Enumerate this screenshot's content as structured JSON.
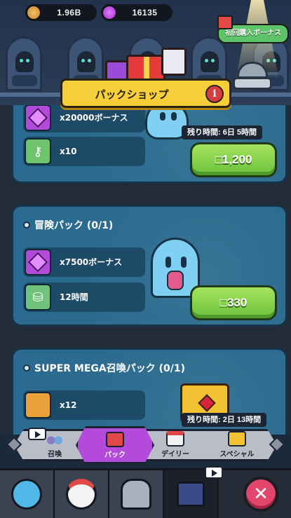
{
  "currency": {
    "coins": "1.96B",
    "gems": "16135",
    "coin_icon": "coin-icon",
    "gem_icon": "gem-icon"
  },
  "first_purchase_bonus": "初回購入ボーナス",
  "banner": {
    "title": "パックショップ",
    "info": "i"
  },
  "packs": [
    {
      "title": "",
      "items": [
        {
          "icon": "gem-icon",
          "label": "x20000ボーナス"
        },
        {
          "icon": "keys-icon",
          "label": "x10"
        }
      ],
      "timer": "残り時間: 6日 5時間",
      "price": "□1,200"
    },
    {
      "title": "冒険パック (0/1)",
      "items": [
        {
          "icon": "gem-icon",
          "label": "x7500ボーナス"
        },
        {
          "icon": "coins-icon",
          "label": "12時間"
        }
      ],
      "timer": "",
      "price": "□330"
    },
    {
      "title": "SUPER MEGA召喚パック (0/1)",
      "items": [
        {
          "icon": "chest-icon",
          "label": "x12"
        }
      ],
      "timer": "残り時間: 2日 13時間",
      "price": ""
    }
  ],
  "tabs": [
    {
      "label": "召喚",
      "icon": "summon-orbs-icon"
    },
    {
      "label": "パック",
      "icon": "gift-box-icon"
    },
    {
      "label": "デイリー",
      "icon": "calendar-icon"
    },
    {
      "label": "スペシャル",
      "icon": "gold-gift-icon"
    }
  ],
  "active_tab": "パック",
  "bottom_nav": [
    {
      "icon": "blue-ghost-icon"
    },
    {
      "icon": "chicken-icon"
    },
    {
      "icon": "ghost-pod-icon"
    },
    {
      "icon": "castle-locked-icon"
    },
    {
      "icon": "close-icon"
    }
  ],
  "colors": {
    "accent_green": "#6bc23c",
    "banner_yellow": "#f7cf3b",
    "tab_purple": "#b34ad9",
    "close_pink": "#e2466d"
  }
}
